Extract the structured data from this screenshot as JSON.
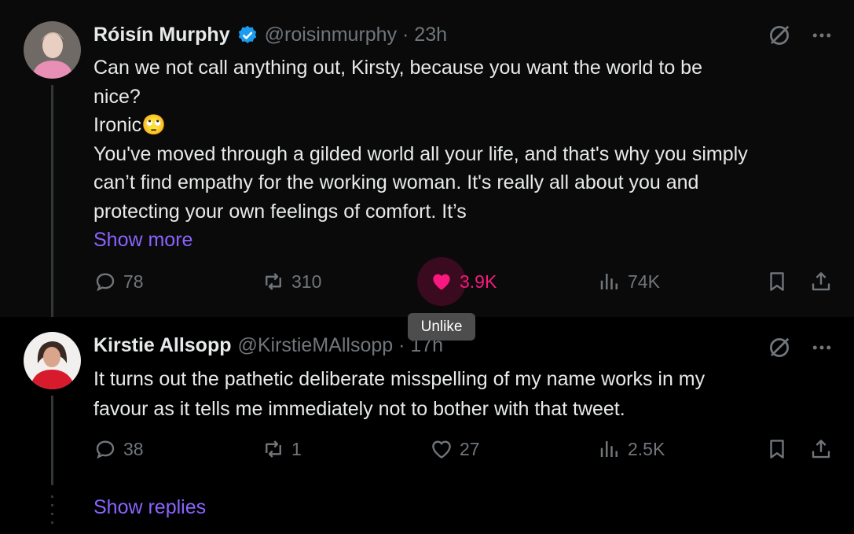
{
  "tweets": [
    {
      "name": "Róisín Murphy",
      "handle": "@roisinmurphy · 23h",
      "lines": [
        "Can we not call anything out, Kirsty, because you want the world to be",
        "nice?",
        "Ironic🙄",
        "You've moved through a gilded world all your life, and that's why you simply",
        "can’t find empathy for the working woman. It's really all about you and",
        "protecting your own feelings of comfort. It’s"
      ],
      "show_more": "Show more",
      "replies": "78",
      "reposts": "310",
      "likes": "3.9K",
      "views": "74K",
      "liked": true
    },
    {
      "name": "Kirstie Allsopp",
      "handle": "@KirstieMAllsopp · 17h",
      "lines": [
        "It turns out the pathetic deliberate misspelling of my name works in my",
        "favour as it tells me immediately not to bother with that tweet."
      ],
      "replies": "38",
      "reposts": "1",
      "likes": "27",
      "views": "2.5K",
      "liked": false
    }
  ],
  "tooltip": "Unlike",
  "show_replies": "Show replies",
  "colors": {
    "accent": "#1d9bf0",
    "like": "#f91880",
    "link": "#8a63ff",
    "muted": "#71767b"
  },
  "icons": [
    "verified-badge-icon",
    "grok-icon",
    "more-icon",
    "reply-icon",
    "repost-icon",
    "heart-icon",
    "views-icon",
    "bookmark-icon",
    "share-icon"
  ]
}
